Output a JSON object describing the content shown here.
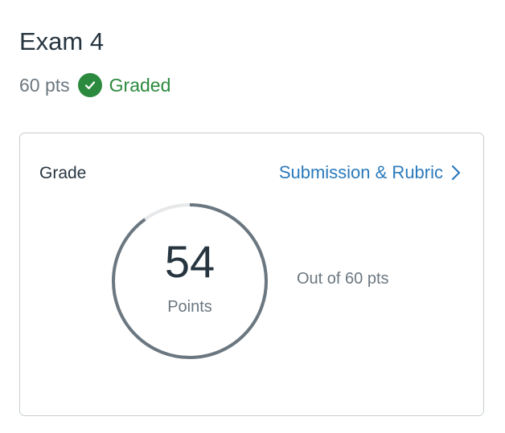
{
  "assignment": {
    "title": "Exam 4",
    "points_possible_text": "60 pts",
    "status": "Graded",
    "status_icon": "check-circle-icon",
    "status_color": "#2b8a3e"
  },
  "grade_card": {
    "title": "Grade",
    "link_label": "Submission & Rubric",
    "link_icon": "chevron-right-icon",
    "link_color": "#2b7abc",
    "score": "54",
    "score_unit": "Points",
    "out_of_text": "Out of 60 pts",
    "progress_fraction": 0.9,
    "ring_color": "#6b7780",
    "ring_track_color": "#e6e8ea"
  }
}
